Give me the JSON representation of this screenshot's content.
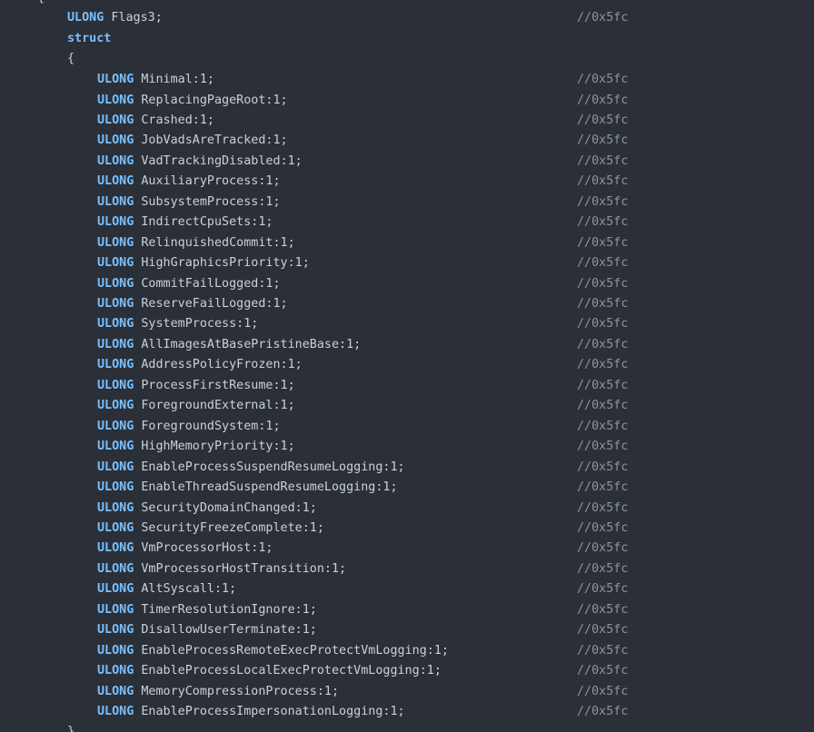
{
  "colors": {
    "background": "#2b2f37",
    "keyword": "#79c0ff",
    "text": "#c9d1d9",
    "comment": "#8b949e"
  },
  "top_partial": "{",
  "flags_line": {
    "type": "ULONG",
    "name": "Flags3;",
    "comment": "//0x5fc"
  },
  "struct_keyword": "struct",
  "open_brace": "{",
  "close_brace": "}",
  "fields": [
    {
      "type": "ULONG",
      "name": "Minimal:1;",
      "comment": "//0x5fc"
    },
    {
      "type": "ULONG",
      "name": "ReplacingPageRoot:1;",
      "comment": "//0x5fc"
    },
    {
      "type": "ULONG",
      "name": "Crashed:1;",
      "comment": "//0x5fc"
    },
    {
      "type": "ULONG",
      "name": "JobVadsAreTracked:1;",
      "comment": "//0x5fc"
    },
    {
      "type": "ULONG",
      "name": "VadTrackingDisabled:1;",
      "comment": "//0x5fc"
    },
    {
      "type": "ULONG",
      "name": "AuxiliaryProcess:1;",
      "comment": "//0x5fc"
    },
    {
      "type": "ULONG",
      "name": "SubsystemProcess:1;",
      "comment": "//0x5fc"
    },
    {
      "type": "ULONG",
      "name": "IndirectCpuSets:1;",
      "comment": "//0x5fc"
    },
    {
      "type": "ULONG",
      "name": "RelinquishedCommit:1;",
      "comment": "//0x5fc"
    },
    {
      "type": "ULONG",
      "name": "HighGraphicsPriority:1;",
      "comment": "//0x5fc"
    },
    {
      "type": "ULONG",
      "name": "CommitFailLogged:1;",
      "comment": "//0x5fc"
    },
    {
      "type": "ULONG",
      "name": "ReserveFailLogged:1;",
      "comment": "//0x5fc"
    },
    {
      "type": "ULONG",
      "name": "SystemProcess:1;",
      "comment": "//0x5fc"
    },
    {
      "type": "ULONG",
      "name": "AllImagesAtBasePristineBase:1;",
      "comment": "//0x5fc"
    },
    {
      "type": "ULONG",
      "name": "AddressPolicyFrozen:1;",
      "comment": "//0x5fc"
    },
    {
      "type": "ULONG",
      "name": "ProcessFirstResume:1;",
      "comment": "//0x5fc"
    },
    {
      "type": "ULONG",
      "name": "ForegroundExternal:1;",
      "comment": "//0x5fc"
    },
    {
      "type": "ULONG",
      "name": "ForegroundSystem:1;",
      "comment": "//0x5fc"
    },
    {
      "type": "ULONG",
      "name": "HighMemoryPriority:1;",
      "comment": "//0x5fc"
    },
    {
      "type": "ULONG",
      "name": "EnableProcessSuspendResumeLogging:1;",
      "comment": "//0x5fc"
    },
    {
      "type": "ULONG",
      "name": "EnableThreadSuspendResumeLogging:1;",
      "comment": "//0x5fc"
    },
    {
      "type": "ULONG",
      "name": "SecurityDomainChanged:1;",
      "comment": "//0x5fc"
    },
    {
      "type": "ULONG",
      "name": "SecurityFreezeComplete:1;",
      "comment": "//0x5fc"
    },
    {
      "type": "ULONG",
      "name": "VmProcessorHost:1;",
      "comment": "//0x5fc"
    },
    {
      "type": "ULONG",
      "name": "VmProcessorHostTransition:1;",
      "comment": "//0x5fc"
    },
    {
      "type": "ULONG",
      "name": "AltSyscall:1;",
      "comment": "//0x5fc"
    },
    {
      "type": "ULONG",
      "name": "TimerResolutionIgnore:1;",
      "comment": "//0x5fc"
    },
    {
      "type": "ULONG",
      "name": "DisallowUserTerminate:1;",
      "comment": "//0x5fc"
    },
    {
      "type": "ULONG",
      "name": "EnableProcessRemoteExecProtectVmLogging:1;",
      "comment": "//0x5fc"
    },
    {
      "type": "ULONG",
      "name": "EnableProcessLocalExecProtectVmLogging:1;",
      "comment": "//0x5fc"
    },
    {
      "type": "ULONG",
      "name": "MemoryCompressionProcess:1;",
      "comment": "//0x5fc"
    },
    {
      "type": "ULONG",
      "name": "EnableProcessImpersonationLogging:1;",
      "comment": "//0x5fc"
    }
  ]
}
